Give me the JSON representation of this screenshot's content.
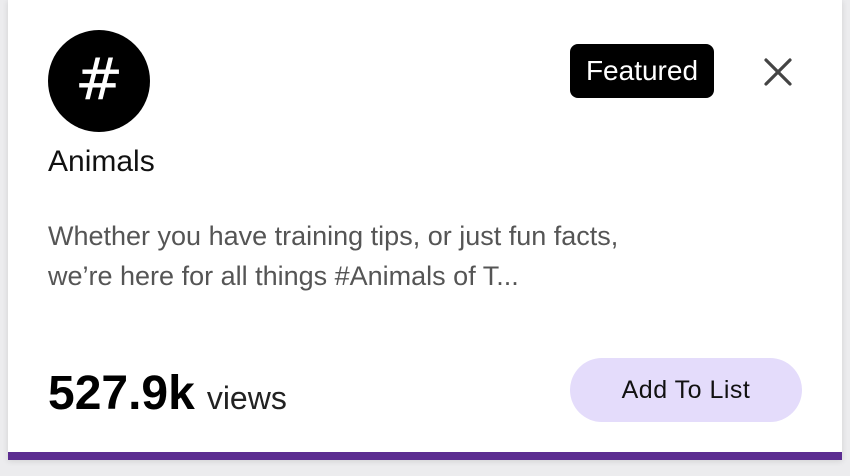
{
  "card": {
    "icon": "hashtag-icon",
    "icon_glyph": "#",
    "title": "Animals",
    "badge": "Featured",
    "close_icon": "close-icon",
    "description_line1": "Whether you have training tips, or just fun facts,",
    "description_line2": "we’re here for all things #Animals of T...",
    "views_count": "527.9k",
    "views_label": "views",
    "add_button_label": "Add To List"
  },
  "colors": {
    "accent_bar": "#5c2d91",
    "button_bg": "#e4dcfb",
    "badge_bg": "#000000"
  }
}
